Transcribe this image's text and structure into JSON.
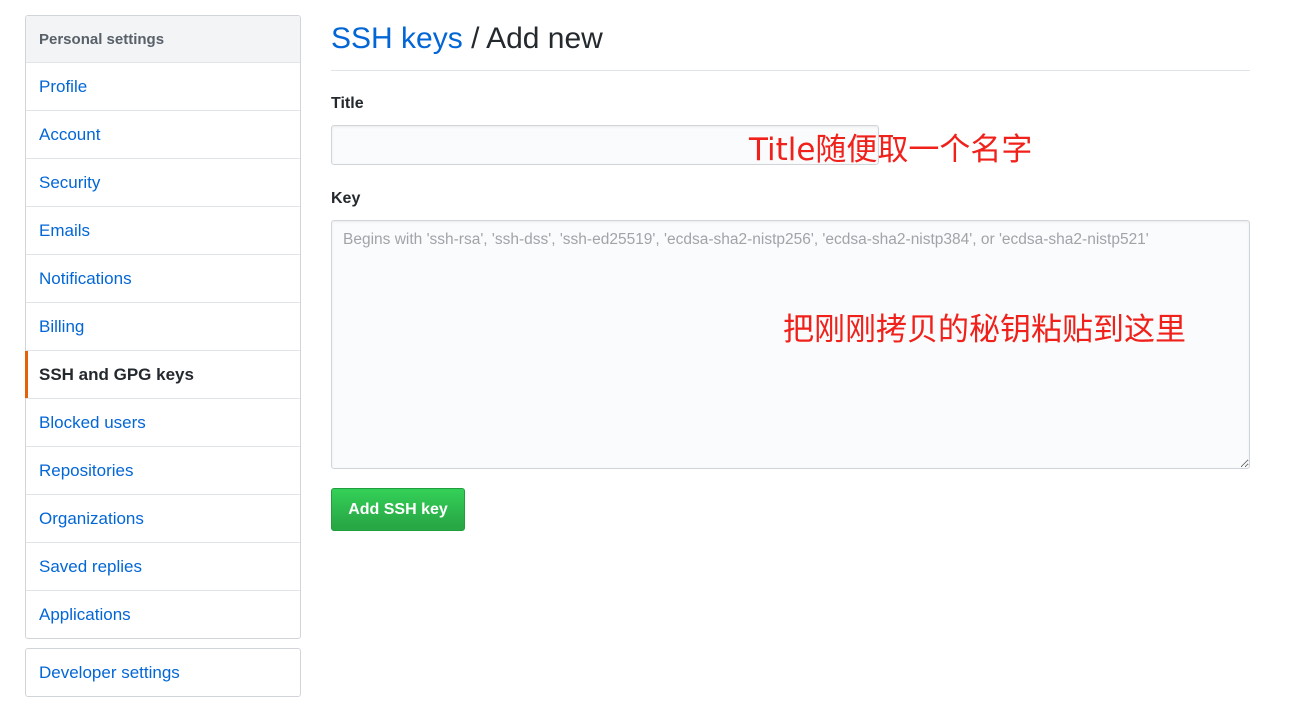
{
  "sidebar": {
    "header": "Personal settings",
    "items": [
      {
        "label": "Profile"
      },
      {
        "label": "Account"
      },
      {
        "label": "Security"
      },
      {
        "label": "Emails"
      },
      {
        "label": "Notifications"
      },
      {
        "label": "Billing"
      },
      {
        "label": "SSH and GPG keys",
        "selected": true
      },
      {
        "label": "Blocked users"
      },
      {
        "label": "Repositories"
      },
      {
        "label": "Organizations"
      },
      {
        "label": "Saved replies"
      },
      {
        "label": "Applications"
      }
    ],
    "developer_settings": "Developer settings"
  },
  "main": {
    "breadcrumb_link": "SSH keys",
    "breadcrumb_separator": "/",
    "breadcrumb_current": "Add new",
    "title_label": "Title",
    "title_value": "",
    "key_label": "Key",
    "key_value": "",
    "key_placeholder": "Begins with 'ssh-rsa', 'ssh-dss', 'ssh-ed25519', 'ecdsa-sha2-nistp256', 'ecdsa-sha2-nistp384', or 'ecdsa-sha2-nistp521'",
    "submit_label": "Add SSH key"
  },
  "annotations": {
    "title_note": "Title随便取一个名字",
    "key_note": "把刚刚拷贝的秘钥粘贴到这里"
  },
  "colors": {
    "link": "#0366d6",
    "selected_marker": "#e36209",
    "button_green": "#28a745",
    "annotation_red": "#f0211a"
  }
}
